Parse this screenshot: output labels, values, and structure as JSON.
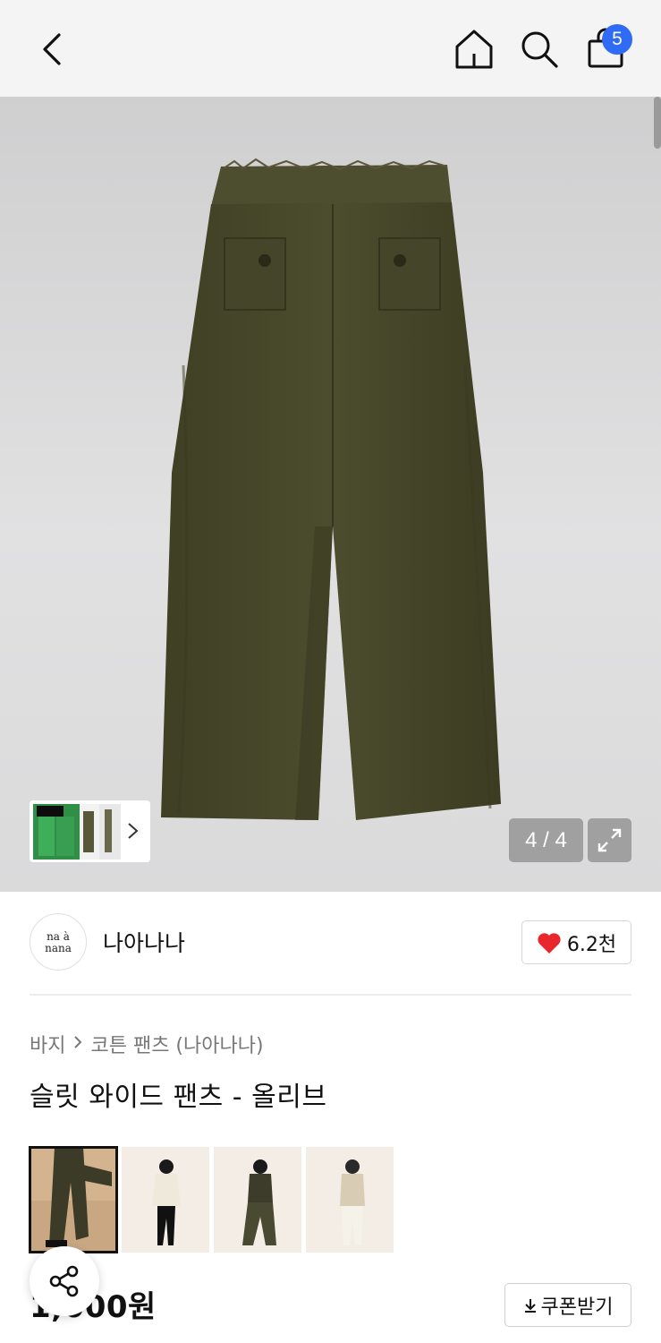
{
  "header": {
    "icons": [
      "back-icon",
      "home-icon",
      "search-icon",
      "cart-icon"
    ],
    "cart_count": "5"
  },
  "gallery_main": {
    "counter": "4 / 4",
    "expand_icon": "expand-icon",
    "thumbnail_more_icon": "chevron-right-icon"
  },
  "brand": {
    "logo_line1": "na à",
    "logo_line2": "nana",
    "name": "나아나나",
    "likes": "6.2천",
    "like_color": "#e8262b"
  },
  "breadcrumb": {
    "category": "바지",
    "subcategory": "코튼 팬츠 (나아나나)"
  },
  "product": {
    "title": "슬릿 와이드 팬츠 - 올리브",
    "price": "1,000원"
  },
  "actions": {
    "coupon_label": "쿠폰받기",
    "share_icon": "share-icon",
    "download_icon": "download-icon"
  },
  "colors": {
    "badge": "#2f6bf5",
    "pants": "#4a4a2c"
  }
}
